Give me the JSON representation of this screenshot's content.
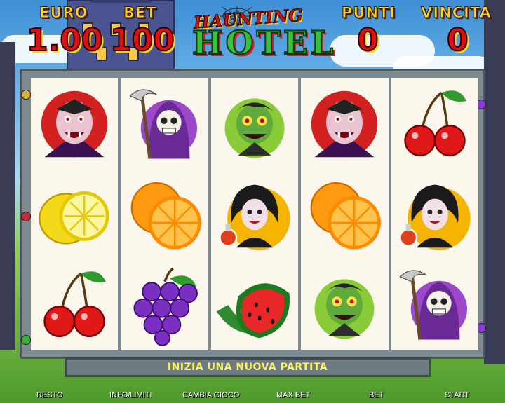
{
  "header": {
    "euro_label": "EURO",
    "euro_value": "1.00",
    "bet_label": "BET",
    "bet_value": "100",
    "punti_label": "PUNTI",
    "punti_value": "0",
    "vincita_label": "VINCITA",
    "vincita_value": "0"
  },
  "logo": {
    "line1": "HAUNTING",
    "line2": "HOTEL"
  },
  "reels": [
    [
      "vampire",
      "lemon",
      "cherry"
    ],
    [
      "grim-reaper",
      "orange",
      "grapes"
    ],
    [
      "zombie",
      "witch",
      "watermelon"
    ],
    [
      "vampire",
      "orange",
      "zombie"
    ],
    [
      "cherry",
      "witch",
      "grim-reaper"
    ]
  ],
  "message": "INIZIA UNA NUOVA PARTITA",
  "buttons": {
    "resto": "RESTO",
    "info": "INFO/LIMITI",
    "cambia": "CAMBIA GIOCO",
    "maxbet": "MAX BET",
    "bet": "BET",
    "start": "START"
  },
  "colors": {
    "label": "#ffd21f",
    "value": "#e01010",
    "message": "#fff06a"
  }
}
